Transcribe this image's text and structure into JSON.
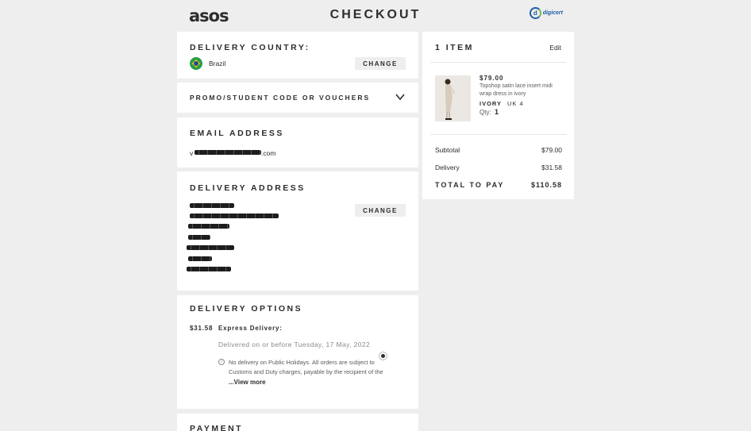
{
  "header": {
    "logo": "asos",
    "title": "CHECKOUT",
    "badge_text": "digicert",
    "badge_mark": "d"
  },
  "delivery_country": {
    "title": "DELIVERY COUNTRY:",
    "country": "Brazil",
    "change_label": "CHANGE"
  },
  "promo": {
    "title": "PROMO/STUDENT CODE OR VOUCHERS"
  },
  "email": {
    "title": "EMAIL ADDRESS",
    "value_prefix": "v",
    "value_suffix": ".com"
  },
  "delivery_address": {
    "title": "DELIVERY ADDRESS",
    "change_label": "CHANGE"
  },
  "delivery_options": {
    "title": "DELIVERY OPTIONS",
    "price": "$31.58",
    "method": "Express Delivery:",
    "eta": "Delivered on or before Tuesday, 17 May, 2022",
    "note_line1": "No delivery on Public Holidays. All orders are subject to",
    "note_line2": "Customs and Duty charges, payable by the recipient of the",
    "view_more": "...View more"
  },
  "payment": {
    "title": "PAYMENT"
  },
  "bag": {
    "title": "1 ITEM",
    "edit_label": "Edit",
    "item": {
      "price": "$79.00",
      "name_line1": "Topshop satin lace insert midi",
      "name_line2": "wrap dress in ivory",
      "color": "IVORY",
      "size": "UK 4",
      "qty_label": "Qty:",
      "qty": "1"
    },
    "subtotal_label": "Subtotal",
    "subtotal": "$79.00",
    "delivery_label": "Delivery",
    "delivery": "$31.58",
    "total_label": "TOTAL TO PAY",
    "total": "$110.58"
  },
  "colors": {
    "background": "#eeeeee",
    "card": "#ffffff",
    "text": "#2d2d2d",
    "button": "#eeeeee",
    "flag_green": "#2a9c48",
    "flag_yellow": "#f4d40f",
    "flag_blue": "#23479b"
  },
  "icons": [
    "brazil-flag-icon",
    "chevron-down-icon",
    "radio-selected-icon",
    "info-icon",
    "digicert-badge-icon"
  ]
}
